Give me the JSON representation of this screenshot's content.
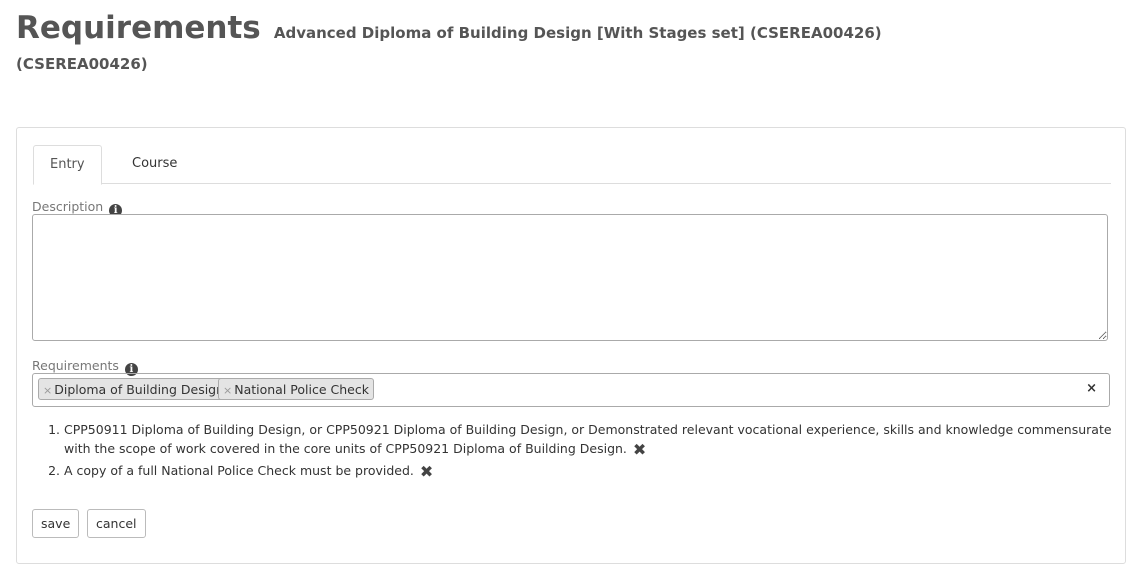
{
  "header": {
    "title": "Requirements",
    "subtitle": "Advanced Diploma of Building Design [With Stages set] (CSEREA00426)",
    "code": "(CSEREA00426)"
  },
  "tabs": [
    {
      "label": "Entry",
      "active": true
    },
    {
      "label": "Course",
      "active": false
    }
  ],
  "description": {
    "label": "Description",
    "value": ""
  },
  "requirements": {
    "label": "Requirements",
    "chips": [
      {
        "label": "Diploma of Building Design"
      },
      {
        "label": "National Police Check"
      }
    ],
    "clear_label": "×",
    "remove_glyph": "×",
    "list": [
      {
        "text": "CPP50911 Diploma of Building Design, or CPP50921 Diploma of Building Design, or Demonstrated relevant vocational experience, skills and knowledge commensurate with the scope of work covered in the core units of CPP50921 Diploma of Building Design."
      },
      {
        "text": "A copy of a full National Police Check must be provided."
      }
    ]
  },
  "icons": {
    "info": "info-icon",
    "remove": "heavy-x-icon"
  },
  "actions": {
    "save_label": "save",
    "cancel_label": "cancel"
  }
}
